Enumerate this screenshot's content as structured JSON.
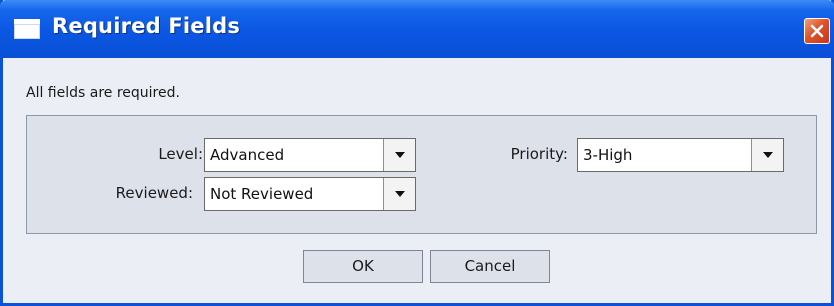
{
  "window": {
    "title": "Required Fields"
  },
  "message": "All fields are required.",
  "fields": {
    "level": {
      "label": "Level:",
      "value": "Advanced"
    },
    "reviewed": {
      "label": "Reviewed:",
      "value": "Not Reviewed"
    },
    "priority": {
      "label": "Priority:",
      "value": "3-High"
    }
  },
  "buttons": {
    "ok": "OK",
    "cancel": "Cancel"
  },
  "colors": {
    "titlebar": "#0b57e3",
    "close_button": "#e0532b",
    "dialog_background": "#eceef6",
    "panel_background": "#dde1ea"
  },
  "icons": {
    "window_icon": "window-icon",
    "close": "close-icon",
    "dropdown": "chevron-down-icon"
  }
}
